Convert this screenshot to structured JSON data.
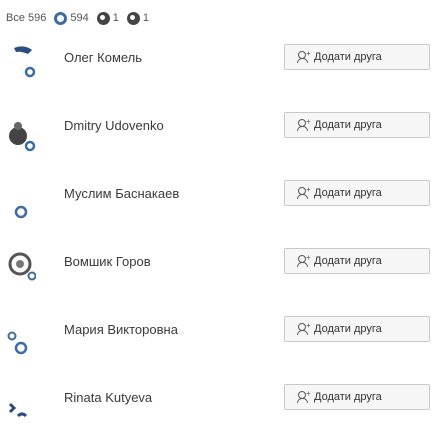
{
  "tabs": [
    {
      "label": "Все",
      "count": "596"
    },
    {
      "count": "594"
    },
    {
      "count": "1"
    },
    {
      "count": "1"
    }
  ],
  "people": [
    {
      "name": "Олег Комель",
      "button": "Додати друга"
    },
    {
      "name": "Dmitry Udovenko",
      "button": "Додати друга"
    },
    {
      "name": "Муслим Баснакаев",
      "button": "Додати друга"
    },
    {
      "name": "Вомшик Горов",
      "button": "Додати друга"
    },
    {
      "name": "Мария Викторовна",
      "button": "Додати друга"
    },
    {
      "name": "Rinata Kutyeva",
      "button": "Додати друга"
    }
  ],
  "colors": {
    "accent": "#3b6ba8",
    "button_bg": "#f6f6f6"
  }
}
